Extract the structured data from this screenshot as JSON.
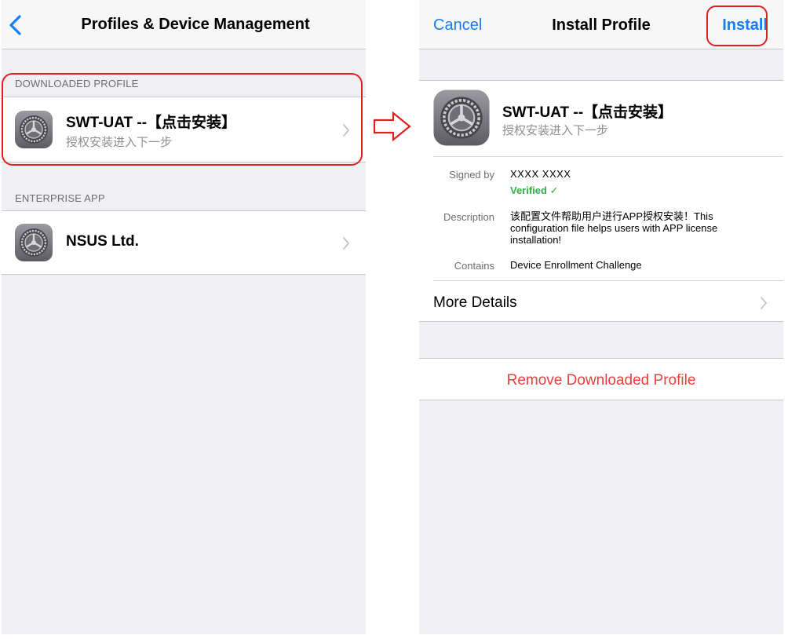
{
  "left_screen": {
    "nav": {
      "title": "Profiles & Device Management"
    },
    "downloaded_section": {
      "header": "DOWNLOADED PROFILE",
      "item": {
        "title": "SWT-UAT --【点击安装】",
        "subtitle": "授权安装进入下一步",
        "icon": "settings-gear-icon"
      }
    },
    "enterprise_section": {
      "header": "ENTERPRISE APP",
      "item": {
        "title": "NSUS Ltd.",
        "icon": "settings-gear-icon"
      }
    }
  },
  "right_screen": {
    "nav": {
      "cancel": "Cancel",
      "title": "Install Profile",
      "install": "Install"
    },
    "profile": {
      "title": "SWT-UAT --【点击安装】",
      "subtitle": "授权安装进入下一步",
      "signed_by_label": "Signed by",
      "signed_by_value": "XXXX XXXX",
      "verified": "Verified ✓",
      "description_label": "Description",
      "description_lines": [
        "该配置文件帮助用户进行APP授权安装！This",
        "configuration file helps users with APP license",
        "installation!"
      ],
      "contains_label": "Contains",
      "contains_value": "Device Enrollment Challenge"
    },
    "more_details": "More Details",
    "remove": "Remove Downloaded Profile"
  },
  "colors": {
    "ios_blue": "#1a7cf0",
    "destructive_red": "#e8403c",
    "verified_green": "#2fb342",
    "annotation_red": "#e02020",
    "group_background": "#efeff4"
  }
}
